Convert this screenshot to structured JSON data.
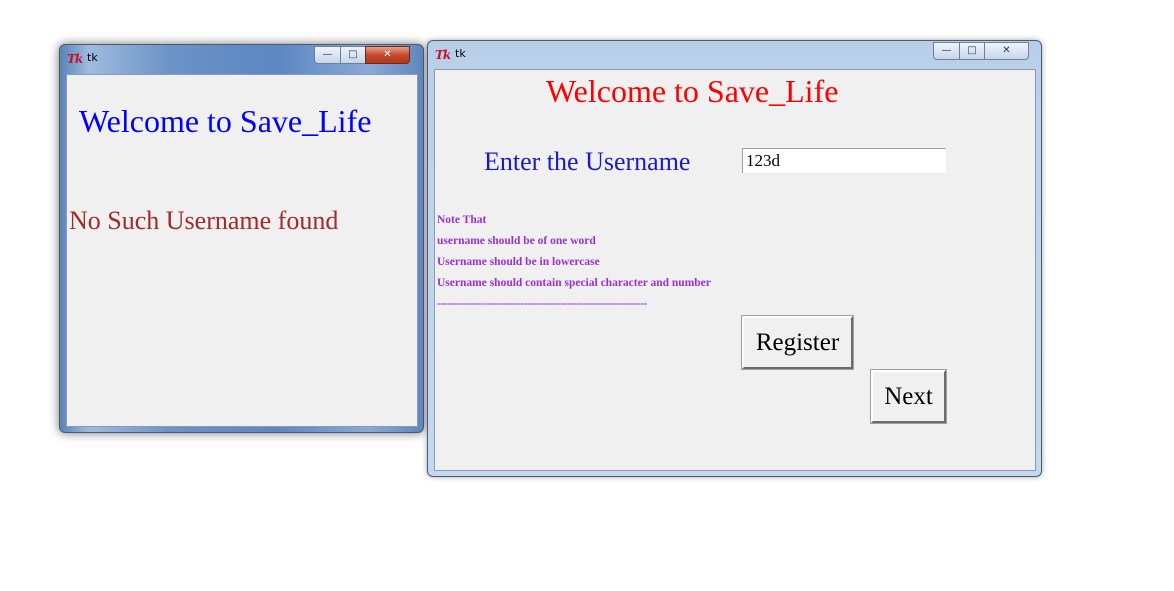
{
  "dialog_window": {
    "title": "tk",
    "welcome_text": "Welcome to Save_Life",
    "message": "No Such Username found",
    "welcome_color": "#0000ff",
    "message_color": "#a52a2a"
  },
  "main_window": {
    "title": "tk",
    "welcome_text": "Welcome to Save_Life",
    "welcome_color": "#ff0000",
    "username_label": "Enter the Username",
    "username_value": "123d",
    "note_lines": [
      "Note That",
      "username should be  of one word",
      "Username should be in lowercase",
      "Username should contain special character and number",
      "---------------------------------------------------------------"
    ],
    "note_color": "#9b30d6",
    "register_button": "Register",
    "next_button": "Next"
  },
  "icons": {
    "app_logo": "tk-feather-icon",
    "minimize": "minimize-icon",
    "maximize": "maximize-icon",
    "close": "close-icon"
  }
}
